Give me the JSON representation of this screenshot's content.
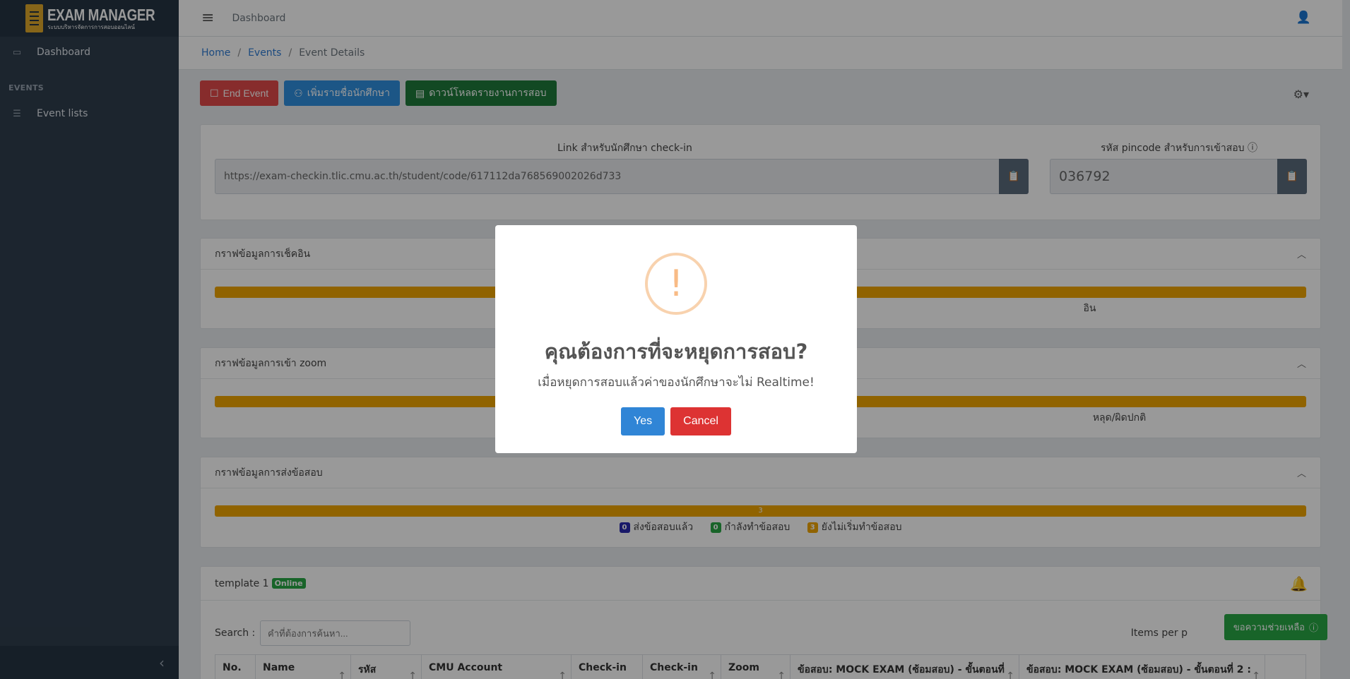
{
  "brand": {
    "title": "EXAM MANAGER",
    "subtitle": "ระบบบริหารจัดการการสอบออนไลน์"
  },
  "sidebar": {
    "items": [
      {
        "label": "Dashboard",
        "icon": "laptop-icon"
      }
    ],
    "section_header": "EVENTS",
    "section_items": [
      {
        "label": "Event lists",
        "icon": "list-icon"
      }
    ],
    "collapse_icon": "‹"
  },
  "topbar": {
    "title": "Dashboard"
  },
  "breadcrumb": {
    "home": "Home",
    "events": "Events",
    "current": "Event Details",
    "separator": "/"
  },
  "actions": {
    "end_event": "End Event",
    "add_students": "เพิ่มรายชื่อนักศึกษา",
    "download_report": "ดาวน์โหลดรายงานการสอบ"
  },
  "links": {
    "checkin_label": "Link สำหรับนักศึกษา check-in",
    "checkin_url": "https://exam-checkin.tlic.cmu.ac.th/student/code/617112da768569002026d733",
    "pincode_label": "รหัส pincode สำหรับการเข้าสอบ",
    "pincode": "036792"
  },
  "sections": {
    "checkin_chart": {
      "title": "กราฟข้อมูลการเช็คอิน",
      "legend_partial": "อิน"
    },
    "zoom_chart": {
      "title": "กราฟข้อมูลการเข้า zoom",
      "legend_partial": "หลุด/ผิดปกติ"
    },
    "submit_chart": {
      "title": "กราฟข้อมูลการส่งข้อสอบ",
      "bar_label": "3",
      "legend": [
        {
          "count": "0",
          "label": "ส่งข้อสอบแล้ว",
          "color": "#2a2ab0"
        },
        {
          "count": "0",
          "label": "กำลังทำข้อสอบ",
          "color": "#28a745"
        },
        {
          "count": "3",
          "label": "ยังไม่เริ่มทำข้อสอบ",
          "color": "#f0a500"
        }
      ]
    }
  },
  "template_card": {
    "title": "template 1",
    "badge": "Online",
    "search_label": "Search :",
    "search_placeholder": "คำที่ต้องการค้นหา...",
    "items_per_page_label": "Items per p",
    "columns": [
      "No.",
      "Name",
      "รหัส",
      "CMU Account",
      "Check-in",
      "Check-in",
      "Zoom",
      "ข้อสอบ: MOCK EXAM (ซ้อมสอบ) - ขั้นตอนที่",
      "ข้อสอบ: MOCK EXAM (ซ้อมสอบ) - ขั้นตอนที่ 2 :",
      ""
    ]
  },
  "help_button": "ขอความช่วยเหลือ",
  "modal": {
    "icon": "!",
    "title": "คุณต้องการที่จะหยุดการสอบ?",
    "text": "เมื่อหยุดการสอบแล้วค่าของนักศึกษาจะไม่ Realtime!",
    "yes": "Yes",
    "cancel": "Cancel"
  },
  "colors": {
    "sidebar": "#2f3e4e",
    "bar": "#f0a500",
    "yes": "#3085d6",
    "cancel": "#dd3333"
  }
}
